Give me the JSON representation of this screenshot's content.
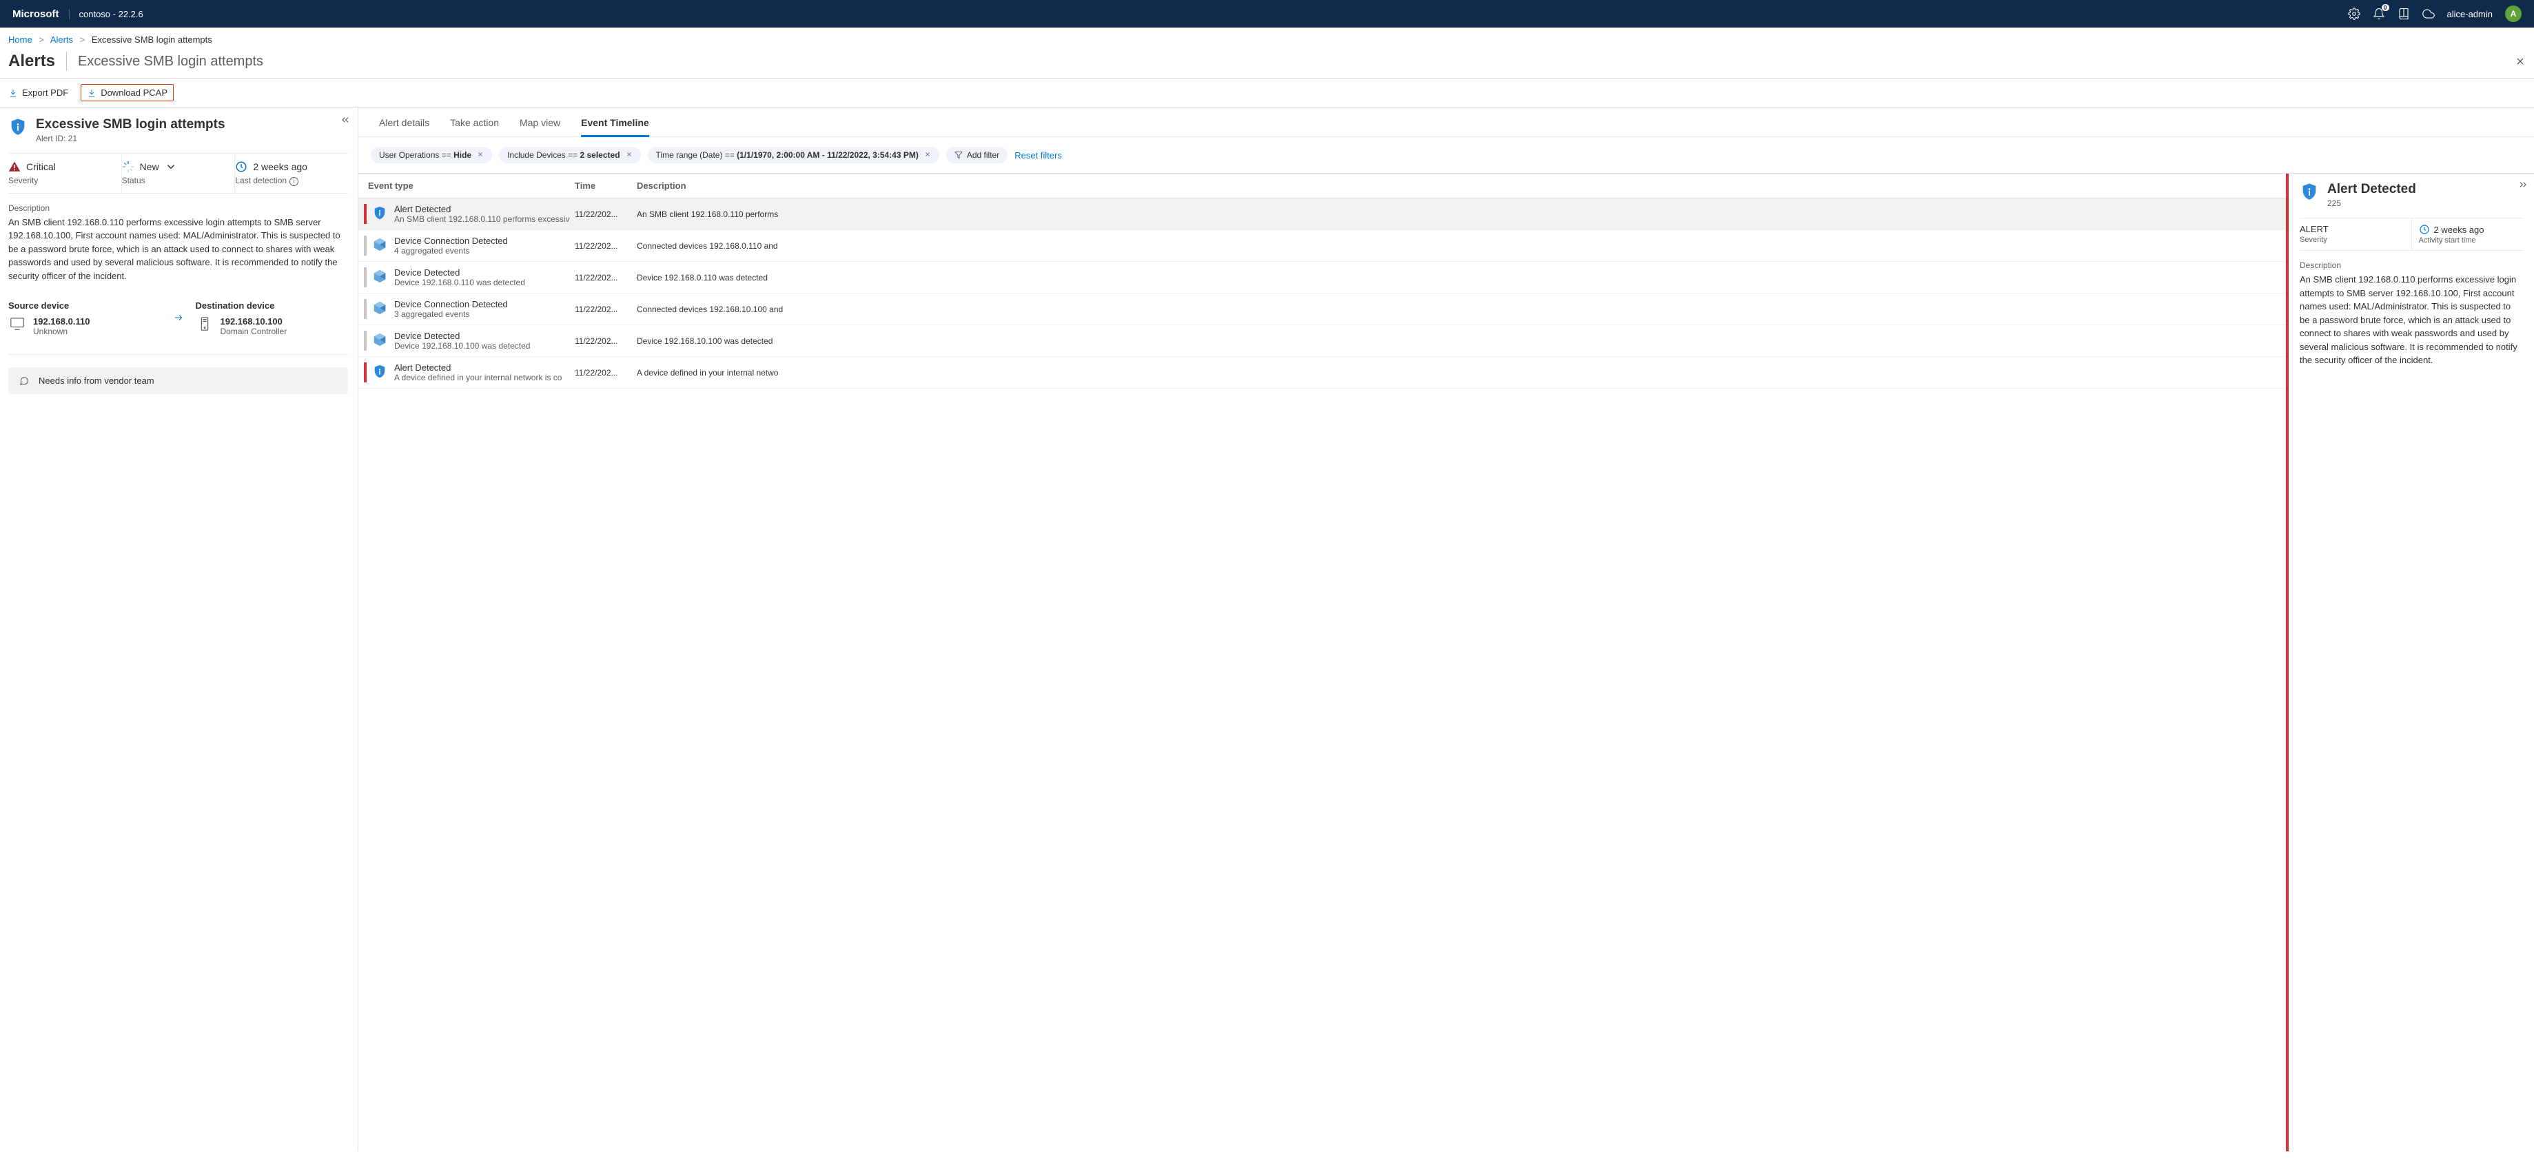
{
  "topbar": {
    "logo": "Microsoft",
    "tenant": "contoso - 22.2.6",
    "notif_count": "0",
    "username": "alice-admin",
    "avatar_initial": "A"
  },
  "breadcrumb": {
    "home": "Home",
    "alerts": "Alerts",
    "current": "Excessive SMB login attempts"
  },
  "header": {
    "title": "Alerts",
    "subtitle": "Excessive SMB login attempts"
  },
  "toolbar": {
    "export_pdf": "Export PDF",
    "download_pcap": "Download PCAP"
  },
  "alert": {
    "title": "Excessive SMB login attempts",
    "id_label": "Alert ID: 21",
    "severity_value": "Critical",
    "severity_label": "Severity",
    "status_value": "New",
    "status_label": "Status",
    "detection_value": "2 weeks ago",
    "detection_label": "Last detection",
    "desc_label": "Description",
    "desc_text": "An SMB client 192.168.0.110 performs excessive login attempts to SMB server 192.168.10.100, First account names used: MAL/Administrator. This is suspected to be a password brute force, which is an attack used to connect to shares with weak passwords and used by several malicious software. It is recommended to notify the security officer of the incident.",
    "src_label": "Source device",
    "src_ip": "192.168.0.110",
    "src_sub": "Unknown",
    "dst_label": "Destination device",
    "dst_ip": "192.168.10.100",
    "dst_sub": "Domain Controller",
    "note": "Needs info from vendor team"
  },
  "tabs": {
    "details": "Alert details",
    "action": "Take action",
    "map": "Map view",
    "timeline": "Event Timeline"
  },
  "filters": {
    "f1_key": "User Operations == ",
    "f1_val": "Hide",
    "f2_key": "Include Devices == ",
    "f2_val": "2 selected",
    "f3_key": "Time range (Date)  == ",
    "f3_val": "(1/1/1970, 2:00:00 AM - 11/22/2022, 3:54:43 PM)",
    "add": "Add filter",
    "reset": "Reset filters"
  },
  "table": {
    "h_type": "Event type",
    "h_time": "Time",
    "h_desc": "Description"
  },
  "events": [
    {
      "sev": "red",
      "kind": "alert",
      "title": "Alert Detected",
      "sub": "An SMB client 192.168.0.110 performs excessiv",
      "time": "11/22/202...",
      "desc": "An SMB client 192.168.0.110 performs"
    },
    {
      "sev": "grey",
      "kind": "device",
      "title": "Device Connection Detected",
      "sub": "4 aggregated events",
      "time": "11/22/202...",
      "desc": "Connected devices 192.168.0.110 and"
    },
    {
      "sev": "grey",
      "kind": "device",
      "title": "Device Detected",
      "sub": "Device 192.168.0.110 was detected",
      "time": "11/22/202...",
      "desc": "Device 192.168.0.110 was detected"
    },
    {
      "sev": "grey",
      "kind": "device",
      "title": "Device Connection Detected",
      "sub": "3 aggregated events",
      "time": "11/22/202...",
      "desc": "Connected devices 192.168.10.100 and"
    },
    {
      "sev": "grey",
      "kind": "device",
      "title": "Device Detected",
      "sub": "Device 192.168.10.100 was detected",
      "time": "11/22/202...",
      "desc": "Device 192.168.10.100 was detected"
    },
    {
      "sev": "red",
      "kind": "alert",
      "title": "Alert Detected",
      "sub": "A device defined in your internal network is co",
      "time": "11/22/202...",
      "desc": "A device defined in your internal netwo"
    }
  ],
  "detail": {
    "title": "Alert Detected",
    "count": "225",
    "sev_val": "ALERT",
    "sev_lab": "Severity",
    "time_val": "2 weeks ago",
    "time_lab": "Activity start time",
    "desc_label": "Description",
    "desc_text": "An SMB client 192.168.0.110 performs excessive login attempts to SMB server 192.168.10.100, First account names used: MAL/Administrator. This is suspected to be a password brute force, which is an attack used to connect to shares with weak passwords and used by several malicious software. It is recommended to notify the security officer of the incident."
  }
}
